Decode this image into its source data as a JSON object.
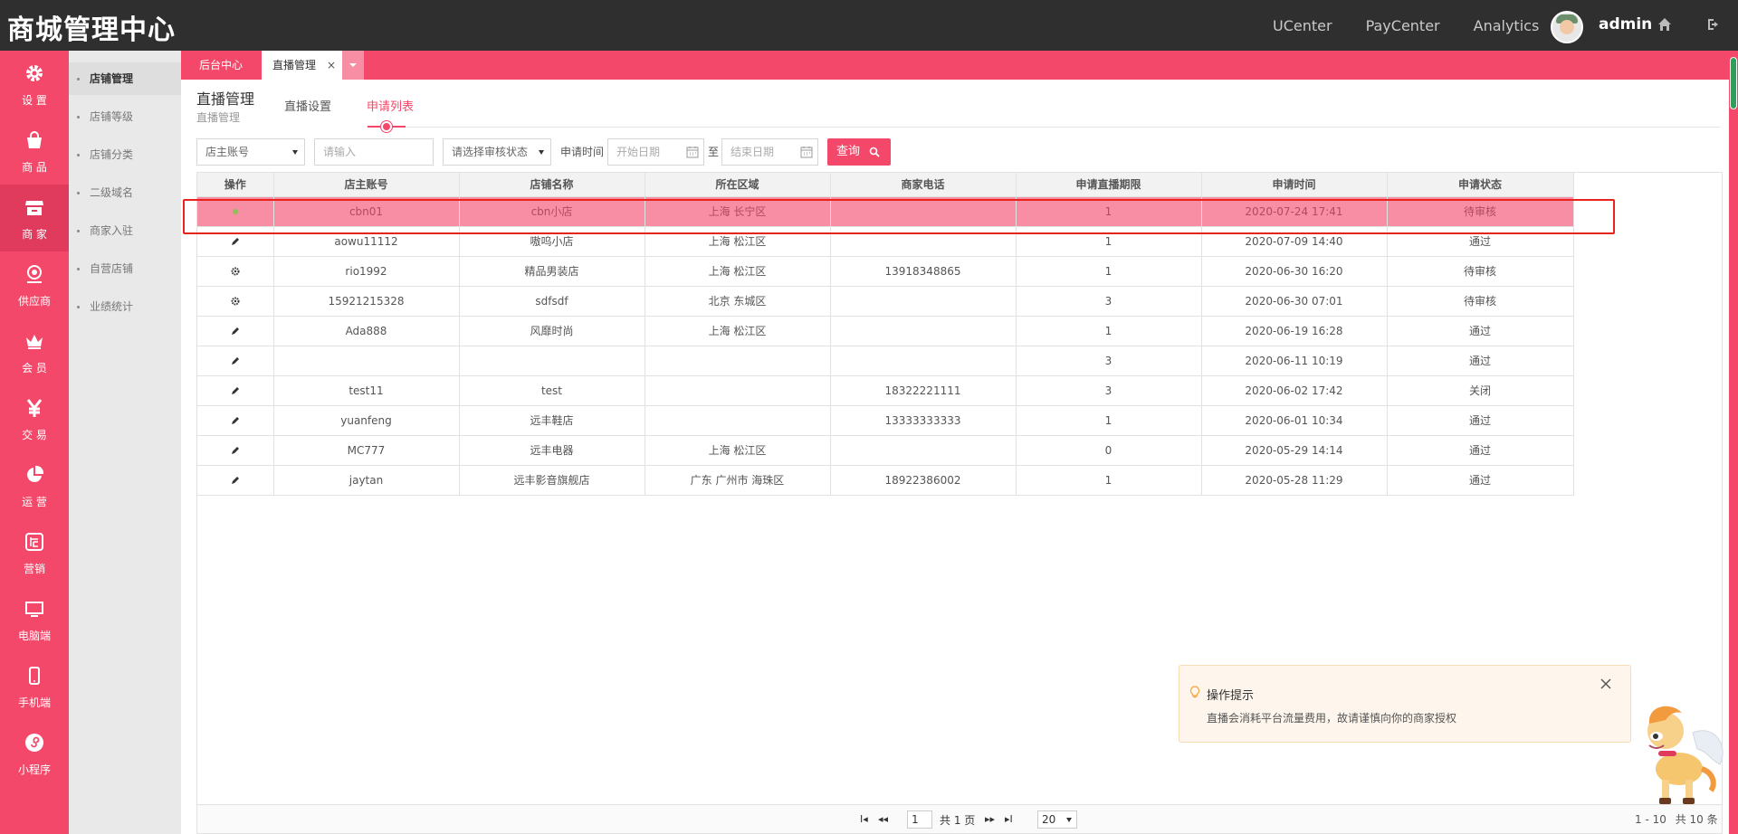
{
  "app": {
    "brand": "商城管理中心",
    "user": "admin"
  },
  "topnav": [
    "UCenter",
    "PayCenter",
    "Analytics"
  ],
  "sidebar": {
    "items": [
      {
        "label": "设 置",
        "icon": "gear-icon"
      },
      {
        "label": "商 品",
        "icon": "shopping-bag-icon"
      },
      {
        "label": "商 家",
        "icon": "store-icon",
        "active": true
      },
      {
        "label": "供应商",
        "icon": "badge-icon"
      },
      {
        "label": "会 员",
        "icon": "crown-icon"
      },
      {
        "label": "交 易",
        "icon": "yen-icon"
      },
      {
        "label": "运 营",
        "icon": "pie-chart-icon"
      },
      {
        "label": "营销",
        "icon": "promo-icon"
      },
      {
        "label": "电脑端",
        "icon": "monitor-icon"
      },
      {
        "label": "手机端",
        "icon": "mobile-icon"
      },
      {
        "label": "小程序",
        "icon": "mini-program-icon"
      }
    ]
  },
  "submenu": {
    "items": [
      "店铺管理",
      "店铺等级",
      "店铺分类",
      "二级域名",
      "商家入驻",
      "自营店铺",
      "业绩统计"
    ]
  },
  "tabs": {
    "home": "后台中心",
    "current": "直播管理",
    "close": "×"
  },
  "page": {
    "title": "直播管理",
    "subtitle": "直播管理",
    "subtabs": [
      "直播设置",
      "申请列表"
    ]
  },
  "filters": {
    "account_select": "店主账号",
    "input_placeholder": "请输入",
    "status_select": "请选择审核状态",
    "time_label": "申请时间",
    "start_placeholder": "开始日期",
    "to_label": "至",
    "end_placeholder": "结束日期",
    "query_label": "查询"
  },
  "table": {
    "headers": [
      "操作",
      "店主账号",
      "店铺名称",
      "所在区域",
      "商家电话",
      "申请直播期限",
      "申请时间",
      "申请状态"
    ],
    "rows": [
      {
        "op": "dot",
        "account": "cbn01",
        "store": "cbn小店",
        "region": "上海 长宁区",
        "phone": "",
        "period": "1",
        "time": "2020-07-24 17:41",
        "status": "待审核"
      },
      {
        "op": "edit",
        "account": "aowu11112",
        "store": "嗷呜小店",
        "region": "上海 松江区",
        "phone": "",
        "period": "1",
        "time": "2020-07-09 14:40",
        "status": "通过"
      },
      {
        "op": "gear",
        "account": "rio1992",
        "store": "精品男装店",
        "region": "上海 松江区",
        "phone": "13918348865",
        "period": "1",
        "time": "2020-06-30 16:20",
        "status": "待审核"
      },
      {
        "op": "gear",
        "account": "15921215328",
        "store": "sdfsdf",
        "region": "北京 东城区",
        "phone": "",
        "period": "3",
        "time": "2020-06-30 07:01",
        "status": "待审核"
      },
      {
        "op": "edit",
        "account": "Ada888",
        "store": "风靡时尚",
        "region": "上海 松江区",
        "phone": "",
        "period": "1",
        "time": "2020-06-19 16:28",
        "status": "通过"
      },
      {
        "op": "edit",
        "account": "",
        "store": "",
        "region": "",
        "phone": "",
        "period": "3",
        "time": "2020-06-11 10:19",
        "status": "通过"
      },
      {
        "op": "edit",
        "account": "test11",
        "store": "test",
        "region": "",
        "phone": "18322221111",
        "period": "3",
        "time": "2020-06-02 17:42",
        "status": "关闭"
      },
      {
        "op": "edit",
        "account": "yuanfeng",
        "store": "远丰鞋店",
        "region": "",
        "phone": "13333333333",
        "period": "1",
        "time": "2020-06-01 10:34",
        "status": "通过"
      },
      {
        "op": "edit",
        "account": "MC777",
        "store": "远丰电器",
        "region": "上海 松江区",
        "phone": "",
        "period": "0",
        "time": "2020-05-29 14:14",
        "status": "通过"
      },
      {
        "op": "edit",
        "account": "jaytan",
        "store": "远丰影音旗舰店",
        "region": "广东 广州市 海珠区",
        "phone": "18922386002",
        "period": "1",
        "time": "2020-05-28 11:29",
        "status": "通过"
      }
    ]
  },
  "pager": {
    "page": "1",
    "total_pages": "共 1 页",
    "page_size": "20",
    "range": "1 - 10",
    "total": "共 10 条"
  },
  "hint": {
    "title": "操作提示",
    "text": "直播会消耗平台流量费用，故请谨慎向你的商家授权"
  },
  "colors": {
    "accent": "#f4486a",
    "topbar": "#2f2f2f",
    "highlight_row": "#f78ea3",
    "outline": "#e8231e"
  }
}
